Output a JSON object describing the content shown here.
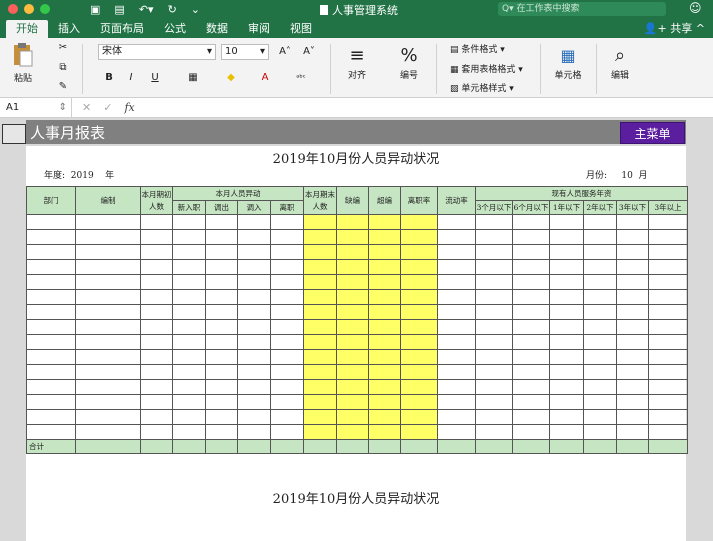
{
  "titlebar": {
    "title": "人事管理系统",
    "search_placeholder": "在工作表中搜索"
  },
  "tabs": [
    "开始",
    "插入",
    "页面布局",
    "公式",
    "数据",
    "审阅",
    "视图"
  ],
  "share_label": "共享",
  "ribbon": {
    "paste": "粘贴",
    "font_name": "宋体",
    "font_size": "10",
    "bold": "B",
    "italic": "I",
    "underline": "U",
    "align": "对齐",
    "number": "编号",
    "conditional": "条件格式",
    "table_format": "套用表格格式",
    "cell_style": "单元格样式",
    "cells": "单元格",
    "edit": "编辑"
  },
  "formula_bar": {
    "cell_ref": "A1",
    "fx": "fx"
  },
  "sheet": {
    "header_title": "人事月报表",
    "main_menu": "主菜单",
    "report_title": "2019年10月份人员异动状况",
    "year_label": "年度:",
    "year_value": "2019",
    "year_unit": "年",
    "month_label": "月份:",
    "month_value": "10",
    "month_unit": "月",
    "total_label": "合计",
    "second_title": "2019年10月份人员异动状况"
  },
  "table": {
    "headers": {
      "dept": "部门",
      "quota": "编制",
      "start_count": "本月期初人数",
      "change_group": "本月人员异动",
      "new": "新入职",
      "out": "调出",
      "in": "调入",
      "leave": "离职",
      "end_count": "本月期末人数",
      "short": "缺编",
      "over": "超编",
      "leave_rate": "离职率",
      "turnover": "流动率",
      "tenure_group": "现有人员服务年资",
      "t1": "3个月以下",
      "t2": "6个月以下",
      "t3": "1年以下",
      "t4": "2年以下",
      "t5": "3年以下",
      "t6": "3年以上"
    },
    "empty_rows": 15
  }
}
